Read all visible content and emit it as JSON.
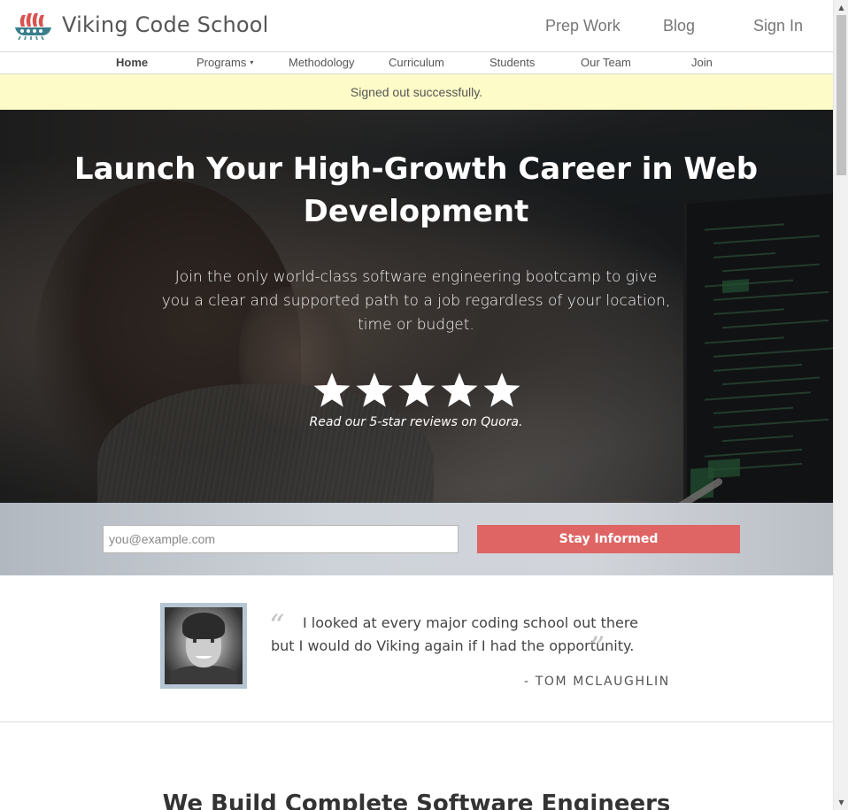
{
  "header": {
    "brand": "Viking Code School",
    "links": [
      "Prep Work",
      "Blog",
      "Sign In"
    ]
  },
  "subnav": {
    "items": [
      "Home",
      "Programs",
      "Methodology",
      "Curriculum",
      "Students",
      "Our Team",
      "Join"
    ],
    "active": "Home",
    "programs_caret": "▾"
  },
  "flash": {
    "message": "Signed out successfully."
  },
  "hero": {
    "title": "Launch Your High-Growth Career in Web Development",
    "subtitle": "Join the only world-class software engineering bootcamp to give you a clear and supported path to a job regardless of your location, time or budget.",
    "star_rating": 5,
    "reviews_link": "Read our 5-star reviews on Quora."
  },
  "signup": {
    "email_placeholder": "you@example.com",
    "email_value": "",
    "button_label": "Stay Informed"
  },
  "testimonial": {
    "open_quote": "“",
    "quote": "I looked at every major coding school out there but I would do Viking again if I had the opportunity.",
    "close_quote": "”",
    "author": "- TOM MCLAUGHLIN"
  },
  "section": {
    "title": "We Build Complete Software Engineers"
  },
  "scrollbar": {
    "up_arrow": "▲",
    "down_arrow": "▼"
  },
  "colors": {
    "accent_button": "#df6565",
    "flash_bg": "#fdfbc7",
    "logo_red": "#d9534f",
    "logo_teal": "#3a7f8c"
  },
  "icons": [
    "viking-ship-logo-icon",
    "star-icon",
    "caret-down-icon",
    "quote-open-icon",
    "quote-close-icon"
  ]
}
